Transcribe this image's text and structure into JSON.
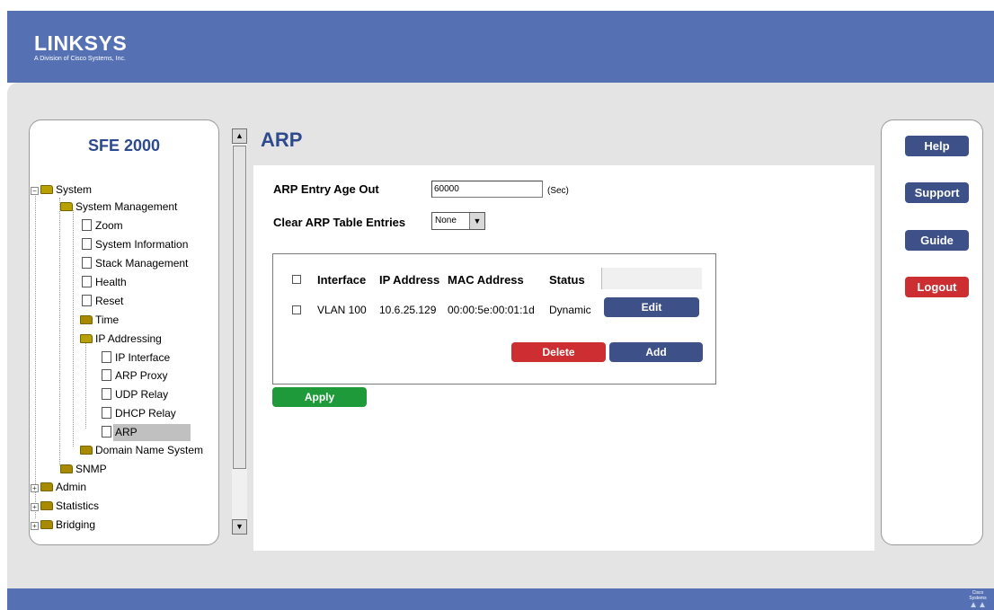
{
  "branding": {
    "title": "LINKSYS",
    "subtitle": "A Division of Cisco Systems, Inc.",
    "footer_mark": "Cisco Systems"
  },
  "device": {
    "name": "SFE 2000"
  },
  "tree": {
    "system": "System",
    "system_management": "System Management",
    "zoom": "Zoom",
    "system_information": "System Information",
    "stack_management": "Stack Management",
    "health": "Health",
    "reset": "Reset",
    "time": "Time",
    "ip_addressing": "IP Addressing",
    "ip_interface": "IP Interface",
    "arp_proxy": "ARP Proxy",
    "udp_relay": "UDP Relay",
    "dhcp_relay": "DHCP Relay",
    "arp": "ARP",
    "domain_name_system": "Domain Name System",
    "snmp": "SNMP",
    "admin": "Admin",
    "statistics": "Statistics",
    "bridging": "Bridging"
  },
  "page": {
    "title": "ARP"
  },
  "form": {
    "age_out_label": "ARP Entry Age Out",
    "age_out_value": "60000",
    "age_out_unit": "(Sec)",
    "clear_label": "Clear ARP Table Entries",
    "clear_value": "None"
  },
  "table": {
    "headers": [
      "Interface",
      "IP Address",
      "MAC Address",
      "Status"
    ],
    "rows": [
      {
        "interface": "VLAN 100",
        "ip": "10.6.25.129",
        "mac": "00:00:5e:00:01:1d",
        "status": "Dynamic",
        "edit_label": "Edit"
      }
    ],
    "delete_label": "Delete",
    "add_label": "Add"
  },
  "actions": {
    "apply_label": "Apply"
  },
  "side_buttons": {
    "help": "Help",
    "support": "Support",
    "guide": "Guide",
    "logout": "Logout"
  },
  "colors": {
    "header": "#5671b3",
    "title": "#2e4a8e",
    "navy_button": "#3e5088",
    "red_button": "#cc2e31",
    "green_button": "#1e9a3a"
  }
}
